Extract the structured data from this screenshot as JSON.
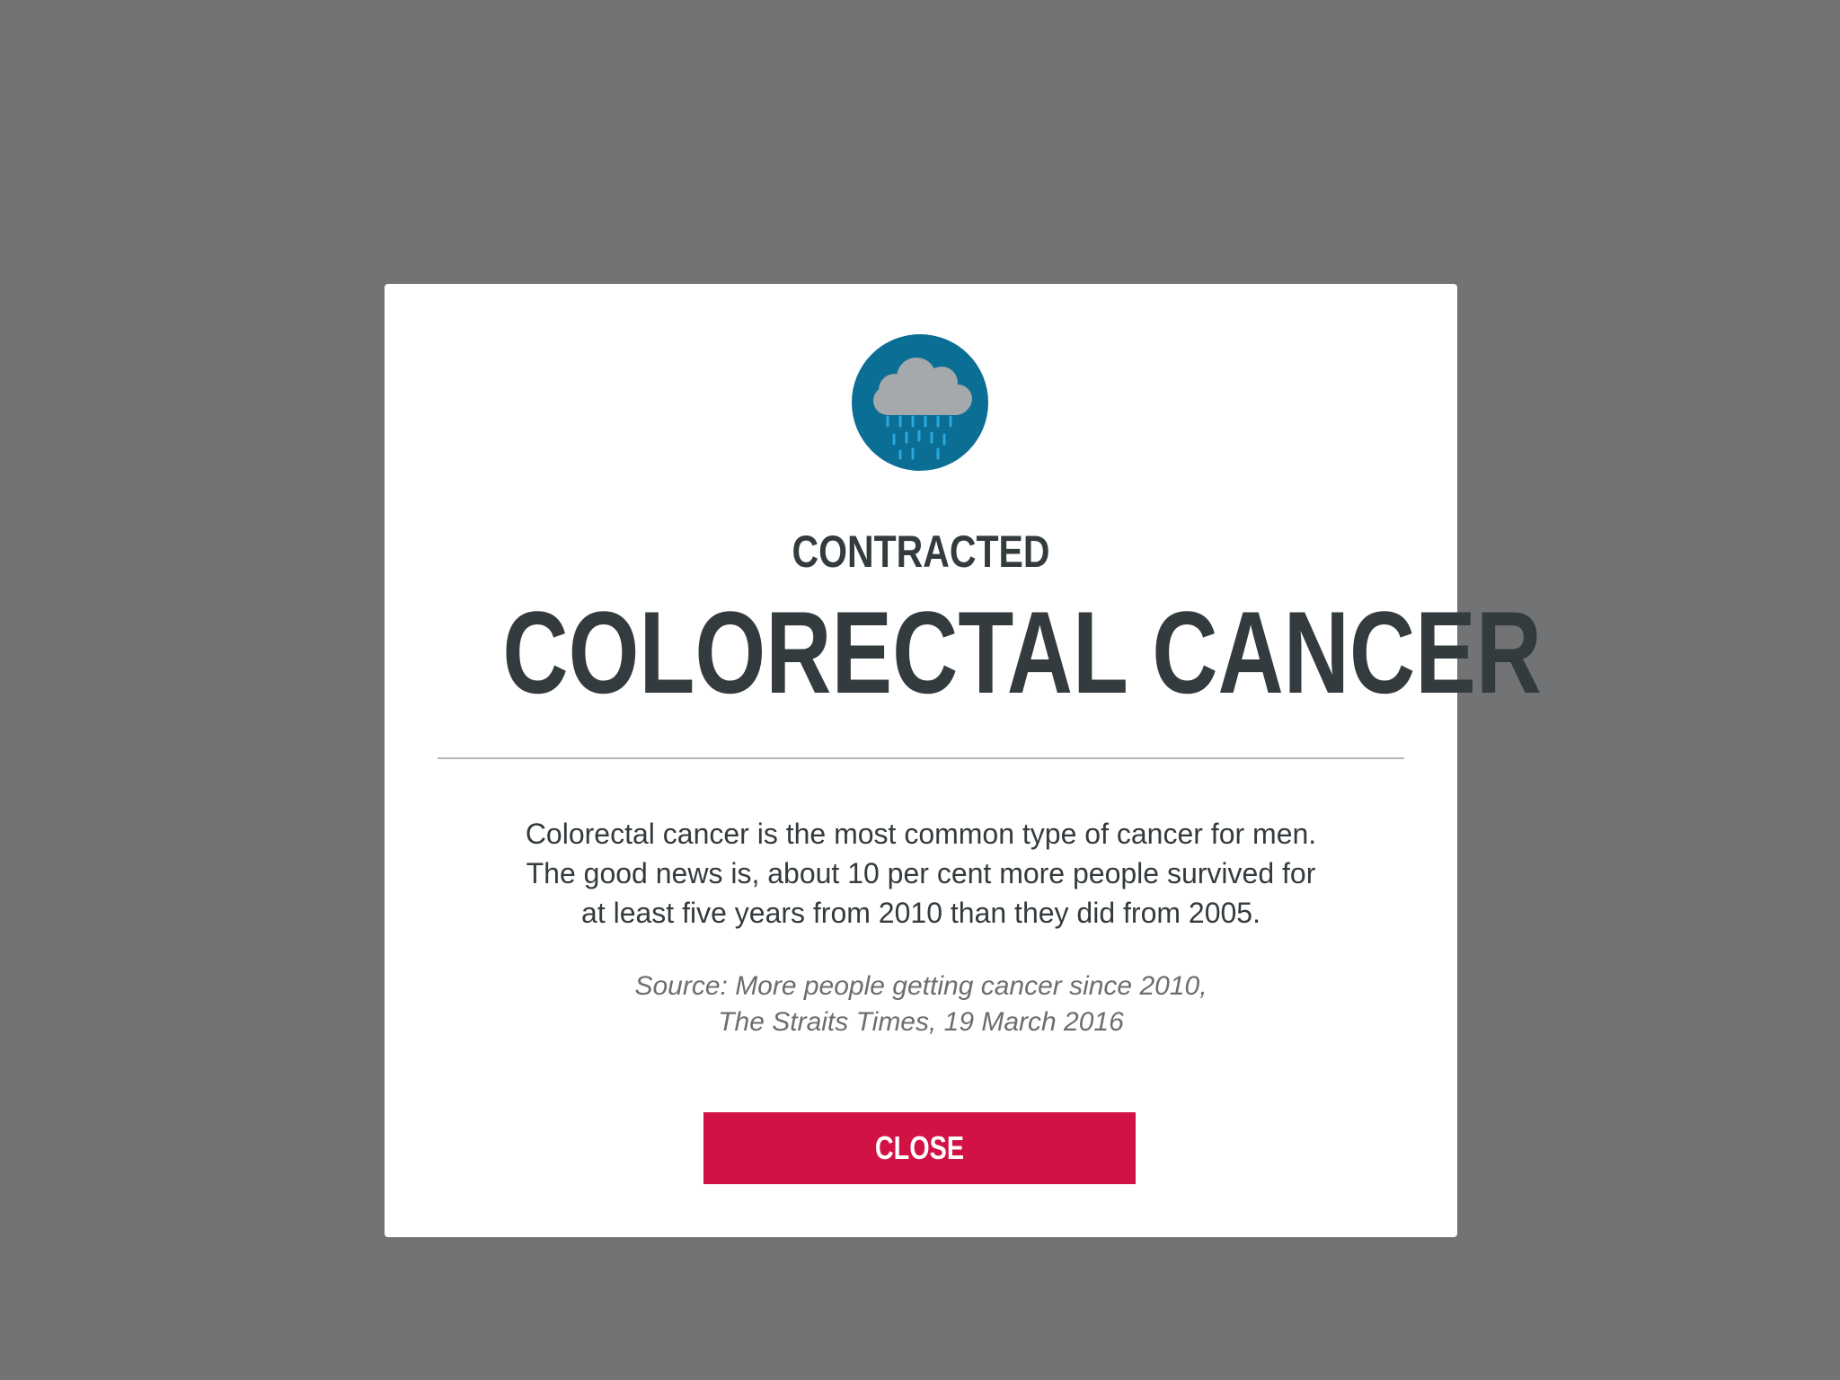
{
  "modal": {
    "icon": "rain-cloud-icon",
    "kicker": "CONTRACTED",
    "title": "COLORECTAL CANCER",
    "body_lines": [
      "Colorectal cancer is the most common type of cancer for men.",
      "The good news is, about 10 per cent more people survived for",
      "at least five years from 2010 than they did from 2005."
    ],
    "source_lines": [
      "Source: More people getting cancer since 2010,",
      "The Straits Times, 19 March 2016"
    ],
    "close_label": "CLOSE"
  },
  "colors": {
    "overlay": "#727375",
    "modal_bg": "#ffffff",
    "icon_circle": "#0b6e94",
    "cloud": "#a5a9ac",
    "rain": "#2aa8e0",
    "heading": "#343b3e",
    "close_button": "#d21145"
  }
}
